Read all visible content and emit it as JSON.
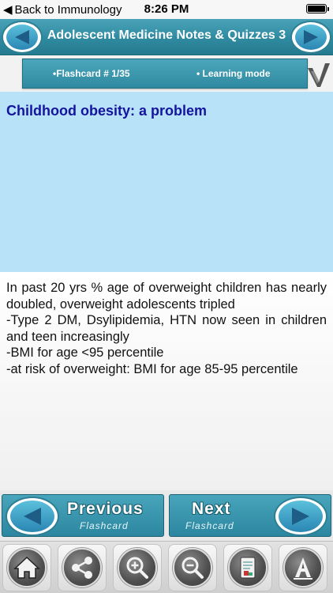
{
  "status_bar": {
    "back_label": "Back to Immunology",
    "time": "8:26 PM"
  },
  "header": {
    "title": "Adolescent Medicine Notes & Quizzes 3"
  },
  "info_bar": {
    "flashcard_label": "•Flashcard #  1/35",
    "mode_label": "• Learning mode"
  },
  "card": {
    "question": "Childhood obesity: a problem",
    "answer_lines": [
      "In past 20 yrs % age of overweight children has nearly doubled, overweight adolescents tripled",
      "-Type 2 DM, Dsylipidemia, HTN now seen in children and teen increasingly",
      "-BMI for age <95 percentile",
      "-at risk of overweight: BMI for age 85-95 percentile"
    ]
  },
  "navigation": {
    "previous_title": "Previous",
    "previous_sub": "Flashcard",
    "next_title": "Next",
    "next_sub": "Flashcard"
  },
  "toolbar": {
    "icons": [
      "home-icon",
      "share-icon",
      "zoom-in-icon",
      "zoom-out-icon",
      "notes-icon",
      "font-icon"
    ]
  },
  "colors": {
    "header_teal": "#2f8aa0",
    "question_bg": "#b7e2f8",
    "question_text": "#14149e",
    "arrow_blue": "#2a86b3"
  }
}
